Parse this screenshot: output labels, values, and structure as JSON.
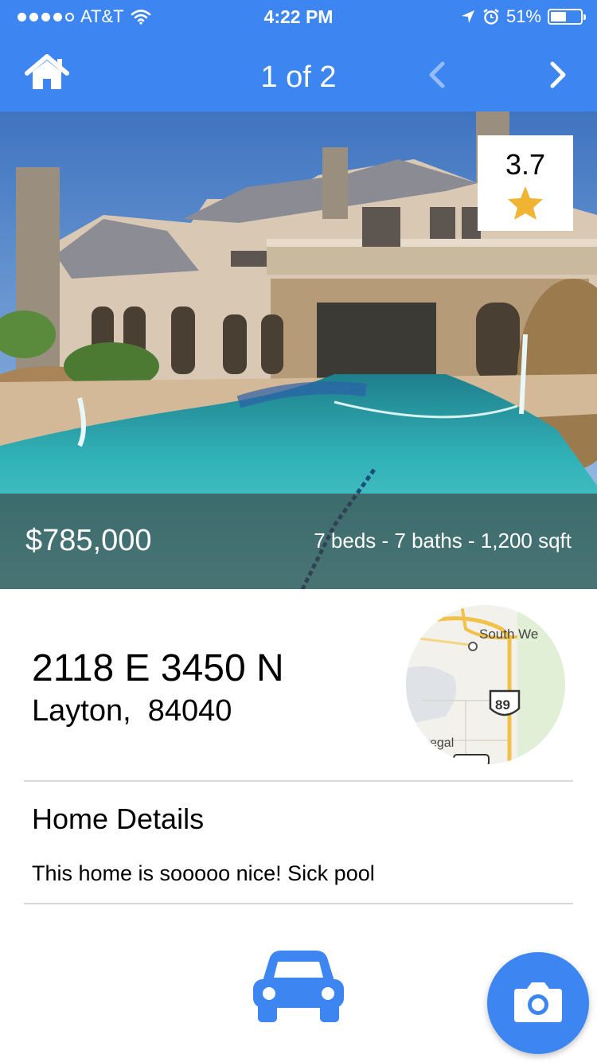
{
  "status_bar": {
    "carrier": "AT&T",
    "time": "4:22 PM",
    "battery": "51%",
    "battery_level": 0.51,
    "icons": [
      "signal-dots",
      "wifi-icon",
      "location-arrow-icon",
      "alarm-icon",
      "battery-icon"
    ]
  },
  "nav": {
    "title": "1 of 2",
    "icons": [
      "home-icon",
      "chevron-left-icon",
      "chevron-right-icon"
    ]
  },
  "listing": {
    "rating": "3.7",
    "price": "$785,000",
    "specs": "7 beds - 7 baths - 1,200 sqft",
    "address_line1": "2118 E 3450 N",
    "address_line2": "Layton,  84040"
  },
  "map": {
    "label_town": "South We",
    "label_highway": "89",
    "label_partial": "egal"
  },
  "details": {
    "title": "Home Details",
    "text": "This home is sooooo nice! Sick pool"
  },
  "actions": {
    "icons": [
      "car-icon",
      "camera-icon"
    ]
  },
  "colors": {
    "accent": "#3d86f2",
    "star": "#f0b432",
    "divider": "#d8d8d8"
  }
}
